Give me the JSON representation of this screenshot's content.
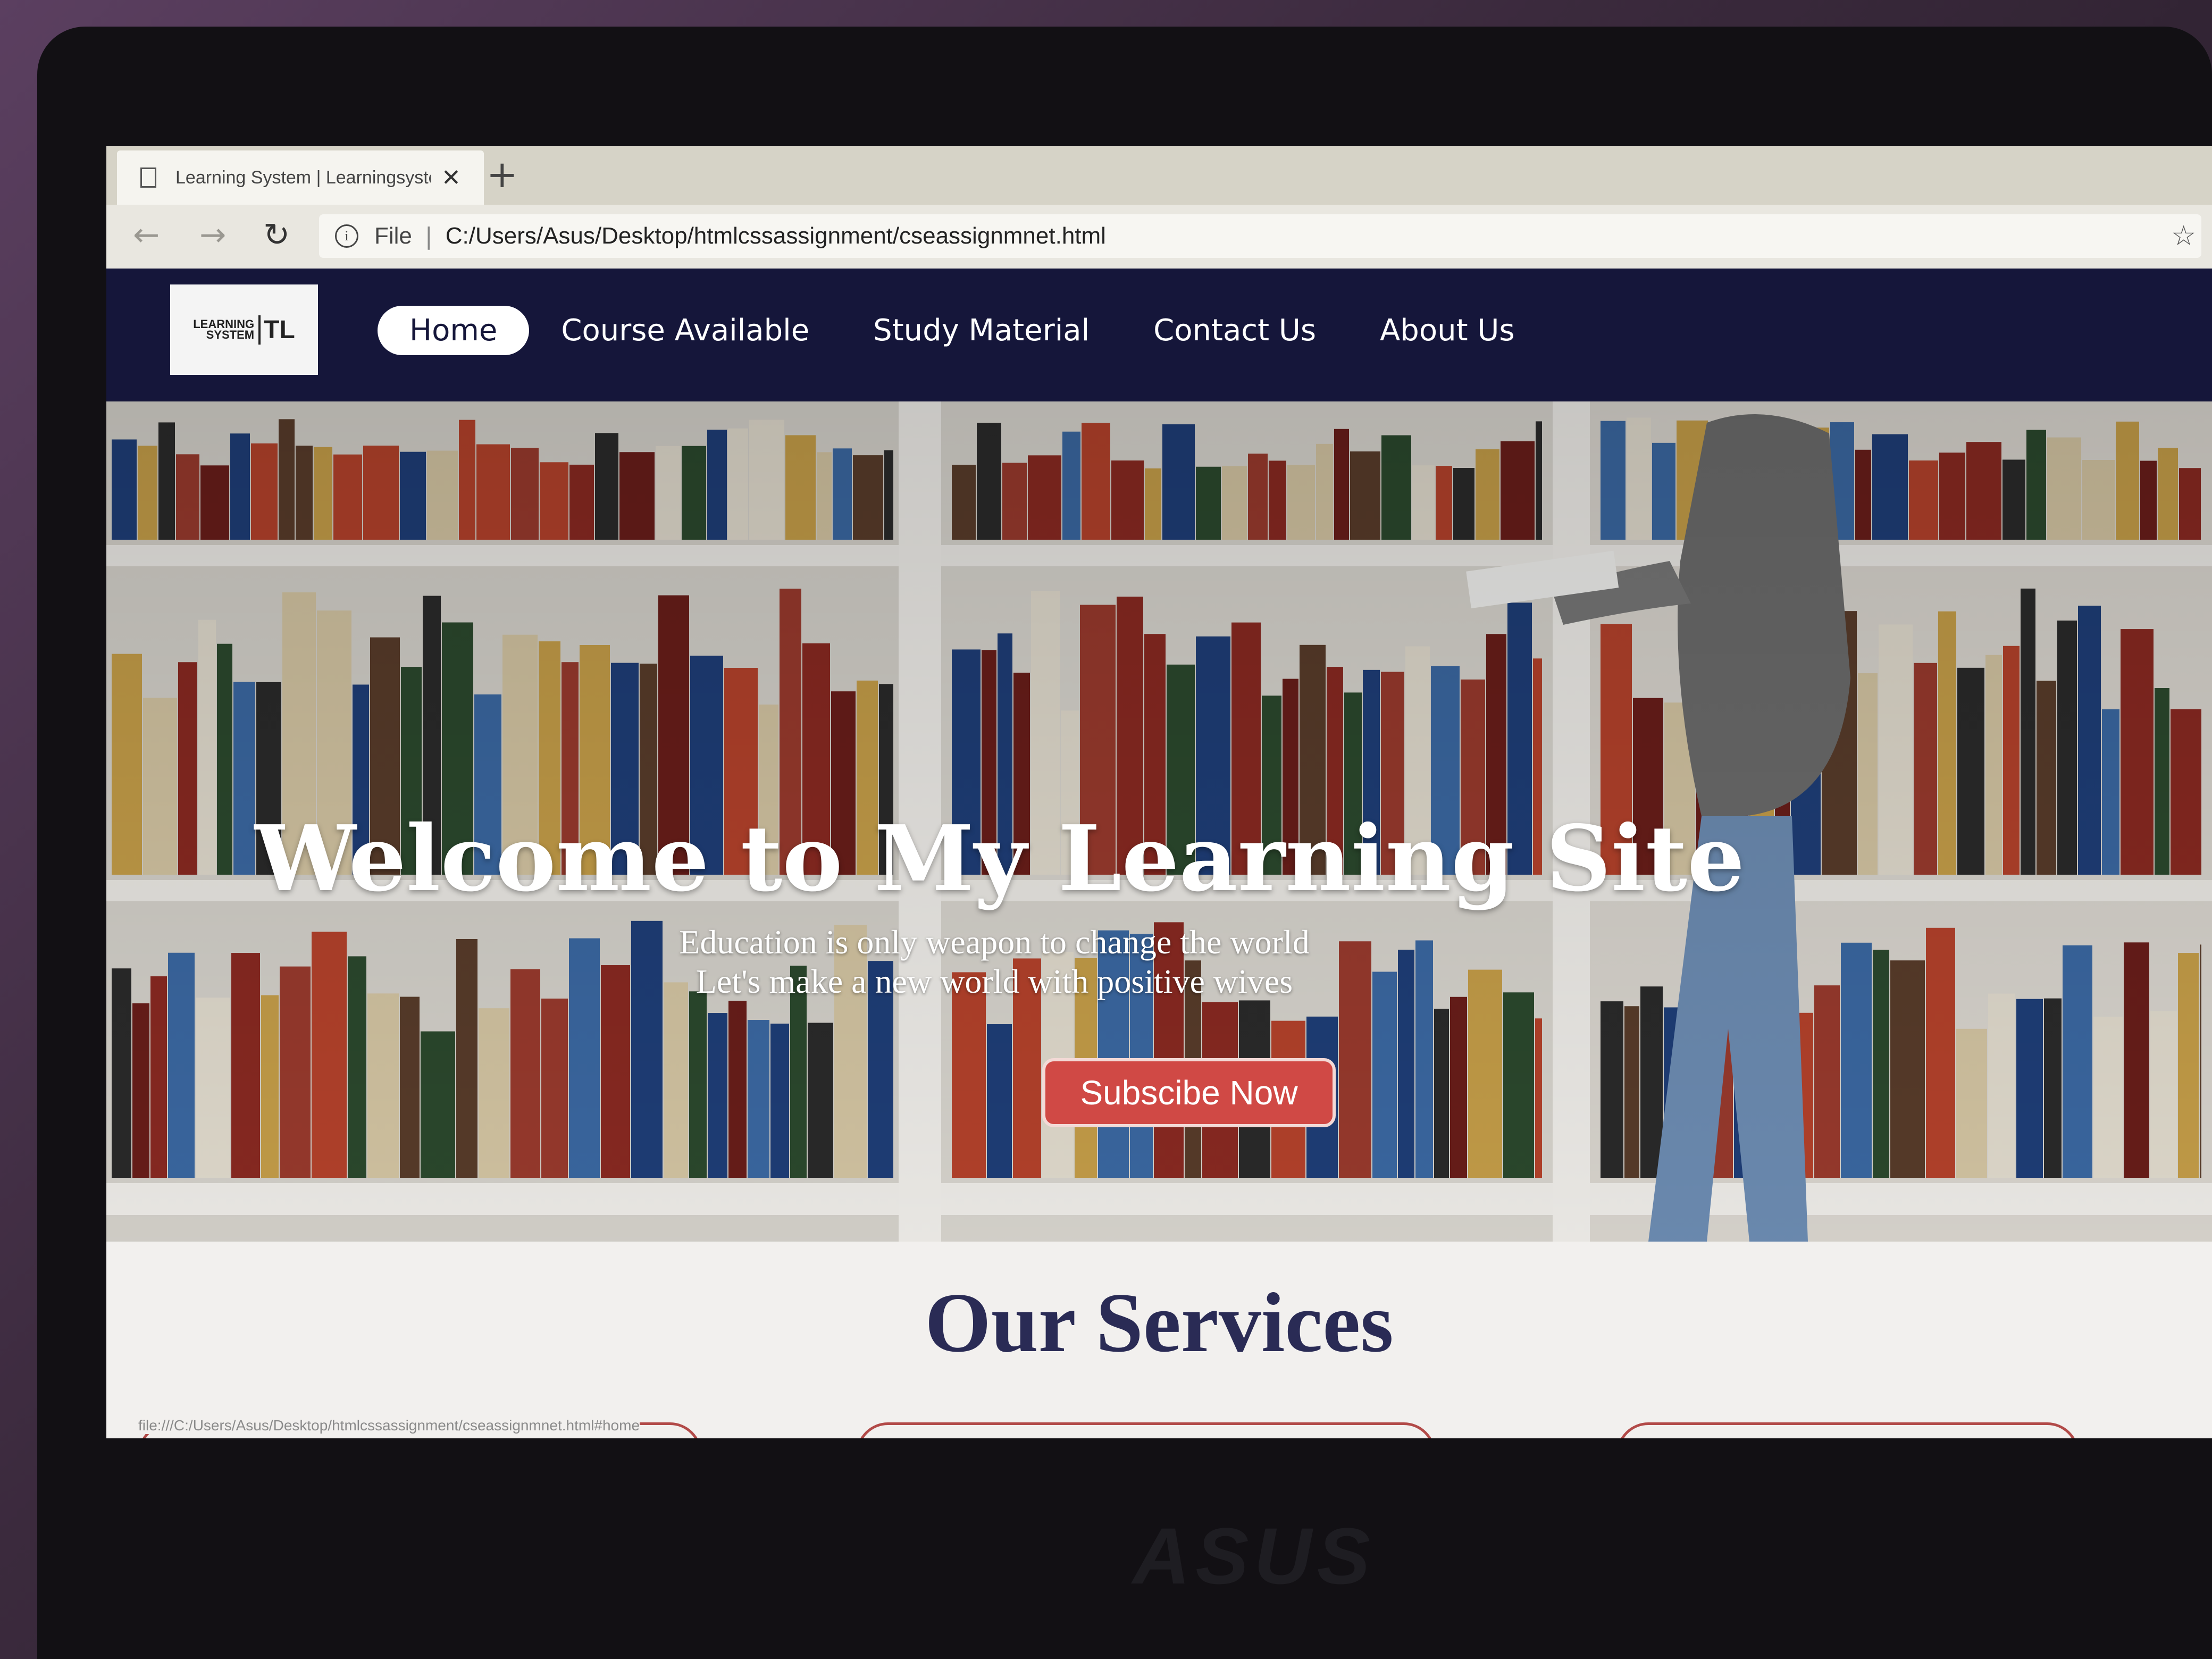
{
  "browser": {
    "tab_title": "Learning System | Learningsystem",
    "new_tab": "+",
    "close": "✕",
    "scheme": "File",
    "address": "C:/Users/Asus/Desktop/htmlcssassignment/cseassignmnet.html",
    "status_url": "file:///C:/Users/Asus/Desktop/htmlcssassignment/cseassignmnet.html#home"
  },
  "site": {
    "logo_line1": "LEARNING",
    "logo_line2": "SYSTEM",
    "logo_mark": "TL",
    "nav": [
      {
        "label": "Home",
        "active": true
      },
      {
        "label": "Course Available"
      },
      {
        "label": "Study Material"
      },
      {
        "label": "Contact Us"
      },
      {
        "label": "About Us"
      }
    ],
    "hero": {
      "title": "Welcome to My Learning Site",
      "subtitle_line1": "Education is only weapon to change the world",
      "subtitle_line2": "Let's make a new world with positive wives",
      "cta": "Subscibe Now"
    },
    "services_title": "Our Services"
  },
  "laptop_brand": "ASUS",
  "colors": {
    "header_bg": "#15163a",
    "cta_bg": "#d04945",
    "services_title": "#2a2b55"
  }
}
